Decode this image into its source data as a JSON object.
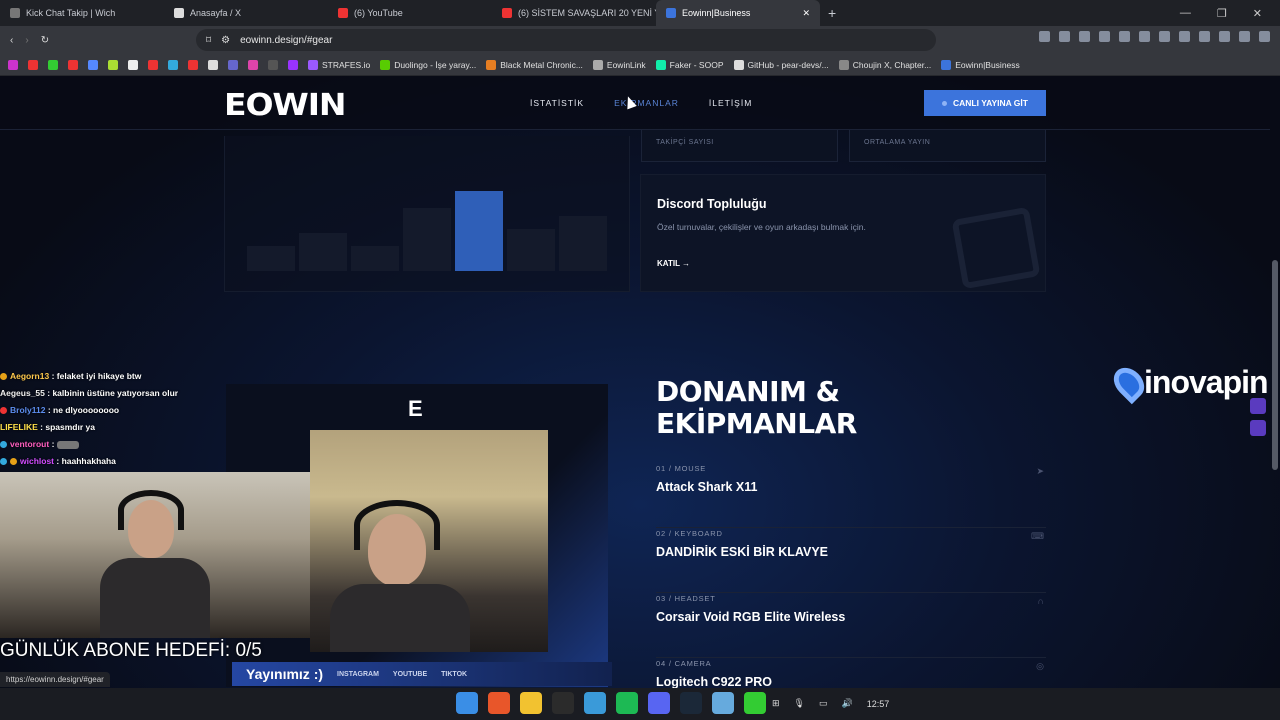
{
  "browser": {
    "tabs": [
      {
        "label": "Kick Chat Takip | Wich",
        "color": "#888"
      },
      {
        "label": "Anasayfa / X",
        "color": "#ddd"
      },
      {
        "label": "(6) YouTube",
        "color": "#e33"
      },
      {
        "label": "(6) SİSTEM SAVAŞLARI 20 YENİ YIL Ö...",
        "color": "#e33"
      },
      {
        "label": "Eowinn|Business",
        "color": "#3c74dc"
      }
    ],
    "new_tab": "+",
    "url": "eowinn.design/#gear",
    "bookmarks": [
      {
        "label": "STRAFES.io",
        "color": "#9b59ff"
      },
      {
        "label": "Duolingo - İşe yaray...",
        "color": "#58cc02"
      },
      {
        "label": "Black Metal Chronic...",
        "color": "#e67e22"
      },
      {
        "label": "EowinLink",
        "color": "#aaa"
      },
      {
        "label": "Faker - SOOP",
        "color": "#1ea"
      },
      {
        "label": "GitHub - pear-devs/...",
        "color": "#ddd"
      },
      {
        "label": "Choujin X, Chapter...",
        "color": "#888"
      },
      {
        "label": "Eowinn|Business",
        "color": "#3c74dc"
      }
    ],
    "status_url": "https://eowinn.design/#gear"
  },
  "site": {
    "logo": "EOWIN",
    "nav": [
      "İSTATİSTİK",
      "EKİPMANLAR",
      "İLETİŞİM"
    ],
    "cta": "CANLI YAYINA GİT",
    "stats": [
      "TAKİPÇİ SAYISI",
      "ORTALAMA YAYIN"
    ],
    "chart_bar_levels": [
      0.3,
      0.45,
      0.3,
      0.75,
      0.95,
      0.5,
      0.65
    ],
    "discord": {
      "title": "Discord Topluluğu",
      "desc": "Özel turnuvalar, çekilişler ve oyun arkadaşı bulmak için.",
      "join": "KATIL",
      "arrow": "→"
    },
    "gear_title_1": "DONANIM &",
    "gear_title_2": "EKİPMANLAR",
    "gear": [
      {
        "cat": "01 / MOUSE",
        "name": "Attack Shark X11",
        "icon": "cursor-icon"
      },
      {
        "cat": "02 / KEYBOARD",
        "name": "DANDİRİK ESKİ BİR KLAVYE",
        "icon": "keyboard-icon"
      },
      {
        "cat": "03 / HEADSET",
        "name": "Corsair Void RGB Elite Wireless",
        "icon": "headset-icon"
      },
      {
        "cat": "04 / CAMERA",
        "name": "Logitech C922 PRO",
        "icon": "camera-icon"
      }
    ]
  },
  "overlay": {
    "chat": [
      {
        "user": "Aegorn13",
        "msg": ": felaket iyi hikaye btw"
      },
      {
        "user": "Aegeus_55",
        "msg": ": kalbinin üstüne yatıyorsan olur"
      },
      {
        "user": "Broly112",
        "msg": ": ne dlyoooooooo"
      },
      {
        "user": "LIFELIKE",
        "msg": ": spasmdır ya"
      },
      {
        "user": "ventorout",
        "msg": ":"
      },
      {
        "user": "wichlost",
        "msg": ": haahhakhaha"
      }
    ],
    "stream_logo": "E",
    "goal": "GÜNLÜK ABONE HEDEFİ: 0/5",
    "yayin_label": "Yayınımız :)",
    "socials": [
      "INSTAGRAM",
      "YOUTUBE",
      "TIKTOK"
    ],
    "sponsor": "inovapin"
  },
  "taskbar": {
    "time": "12:57",
    "apps": [
      "#3a8ee6",
      "#e8562a",
      "#f2c230",
      "#2b2b2b",
      "#3a9ad9",
      "#1db954",
      "#5865f2",
      "#1b2838",
      "#6ad",
      "#3c3"
    ]
  }
}
